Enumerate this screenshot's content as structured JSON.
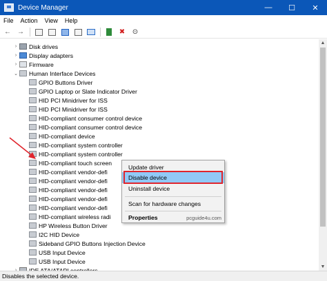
{
  "window": {
    "title": "Device Manager",
    "minimize_glyph": "—",
    "maximize_glyph": "☐",
    "close_glyph": "✕"
  },
  "menu": [
    "File",
    "Action",
    "View",
    "Help"
  ],
  "toolbar": {
    "back_icon": "←",
    "forward_icon": "→",
    "remove_icon": "✖",
    "download_icon": "⊙"
  },
  "tree": {
    "expand_glyph": "›",
    "collapse_glyph": "⌄",
    "categories": [
      {
        "label": "Disk drives",
        "icon": "disk-drive-icon",
        "expanded": false
      },
      {
        "label": "Display adapters",
        "icon": "display-adapter-icon",
        "expanded": false
      },
      {
        "label": "Firmware",
        "icon": "firmware-icon",
        "expanded": false
      },
      {
        "label": "Human Interface Devices",
        "icon": "hid-icon",
        "expanded": true
      }
    ],
    "hid_children": [
      "GPIO Buttons Driver",
      "GPIO Laptop or Slate Indicator Driver",
      "HID PCI Minidriver for ISS",
      "HID PCI Minidriver for ISS",
      "HID-compliant consumer control device",
      "HID-compliant consumer control device",
      "HID-compliant device",
      "HID-compliant system controller",
      "HID-compliant system controller",
      "HID-compliant touch screen",
      "HID-compliant vendor-defi",
      "HID-compliant vendor-defi",
      "HID-compliant vendor-defi",
      "HID-compliant vendor-defi",
      "HID-compliant vendor-defi",
      "HID-compliant wireless radi",
      "HP Wireless Button Driver",
      "I2C HID Device",
      "Sideband GPIO Buttons Injection Device",
      "USB Input Device",
      "USB Input Device"
    ],
    "after": [
      {
        "label": "IDE ATA/ATAPI controllers",
        "icon": "ide-controller-icon",
        "expanded": false
      }
    ]
  },
  "context_menu": {
    "items": [
      "Update driver",
      "Disable device",
      "Uninstall device",
      "Scan for hardware changes",
      "Properties"
    ],
    "highlighted": "Disable device",
    "watermark": "pcguide4u.com"
  },
  "statusbar": {
    "text": "Disables the selected device."
  },
  "colors": {
    "titlebar": "#0b57b8",
    "highlight": "#91c9f7",
    "annotation": "#e0242c"
  }
}
